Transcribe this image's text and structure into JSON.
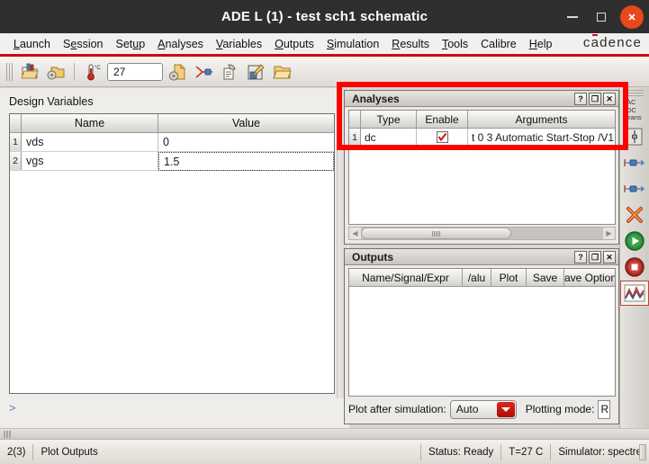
{
  "window": {
    "title": "ADE L (1) - test sch1 schematic",
    "brand": "cadence",
    "minimize_label": "—",
    "maximize_label": "□",
    "close_label": "✕"
  },
  "menubar": {
    "items": [
      {
        "label": "Launch",
        "mnemonic": "L"
      },
      {
        "label": "Session",
        "mnemonic": "e"
      },
      {
        "label": "Setup",
        "mnemonic": "u"
      },
      {
        "label": "Analyses",
        "mnemonic": "A"
      },
      {
        "label": "Variables",
        "mnemonic": "V"
      },
      {
        "label": "Outputs",
        "mnemonic": "O"
      },
      {
        "label": "Simulation",
        "mnemonic": "S"
      },
      {
        "label": "Results",
        "mnemonic": "R"
      },
      {
        "label": "Tools",
        "mnemonic": "T"
      },
      {
        "label": "Calibre",
        "mnemonic": ""
      },
      {
        "label": "Help",
        "mnemonic": "H"
      }
    ]
  },
  "toolbar": {
    "temperature_value": "27",
    "temperature_unit": "°C",
    "icons": [
      "open-results-icon",
      "setup-folder-icon",
      "temperature-icon",
      "setup-simulation-icon",
      "netlist-icon",
      "print-icon",
      "edit-variables-icon",
      "open-folder-icon"
    ]
  },
  "design_variables": {
    "title": "Design Variables",
    "columns": [
      "Name",
      "Value"
    ],
    "rows": [
      {
        "index": "1",
        "name": "vds",
        "value": "0",
        "selected": false
      },
      {
        "index": "2",
        "name": "vgs",
        "value": "1.5",
        "selected": true
      }
    ],
    "prompt": ">"
  },
  "analyses": {
    "title": "Analyses",
    "window_buttons": [
      "?",
      "❐",
      "✕"
    ],
    "columns": [
      "Type",
      "Enable",
      "Arguments"
    ],
    "rows": [
      {
        "index": "1",
        "type": "dc",
        "enabled": true,
        "arguments": "t 0 3 Automatic Start-Stop /V1"
      }
    ]
  },
  "outputs": {
    "title": "Outputs",
    "window_buttons": [
      "?",
      "❐",
      "✕"
    ],
    "columns": [
      "Name/Signal/Expr",
      "/alu",
      "Plot",
      "Save",
      "Save Options"
    ],
    "rows": [],
    "plot_after_simulation_label": "Plot after simulation:",
    "plot_after_simulation_value": "Auto",
    "plotting_mode_label": "Plotting mode:",
    "plotting_mode_value": "R"
  },
  "sidebar": {
    "analysis_labels": [
      "AC",
      "DC",
      "trans"
    ],
    "icons": [
      "analyses-choose-icon",
      "edit-variables-icon",
      "outputs-setup-icon",
      "outputs-to-be-saved-icon",
      "delete-icon",
      "run-simulation-icon",
      "stop-simulation-icon",
      "plot-outputs-icon"
    ]
  },
  "statusbar": {
    "counter": "2(3)",
    "message": "Plot Outputs",
    "status": "Status: Ready",
    "temperature": "T=27  C",
    "simulator": "Simulator: spectre"
  },
  "annotation": {
    "color": "#ff0000",
    "target": "analyses-panel-row"
  }
}
